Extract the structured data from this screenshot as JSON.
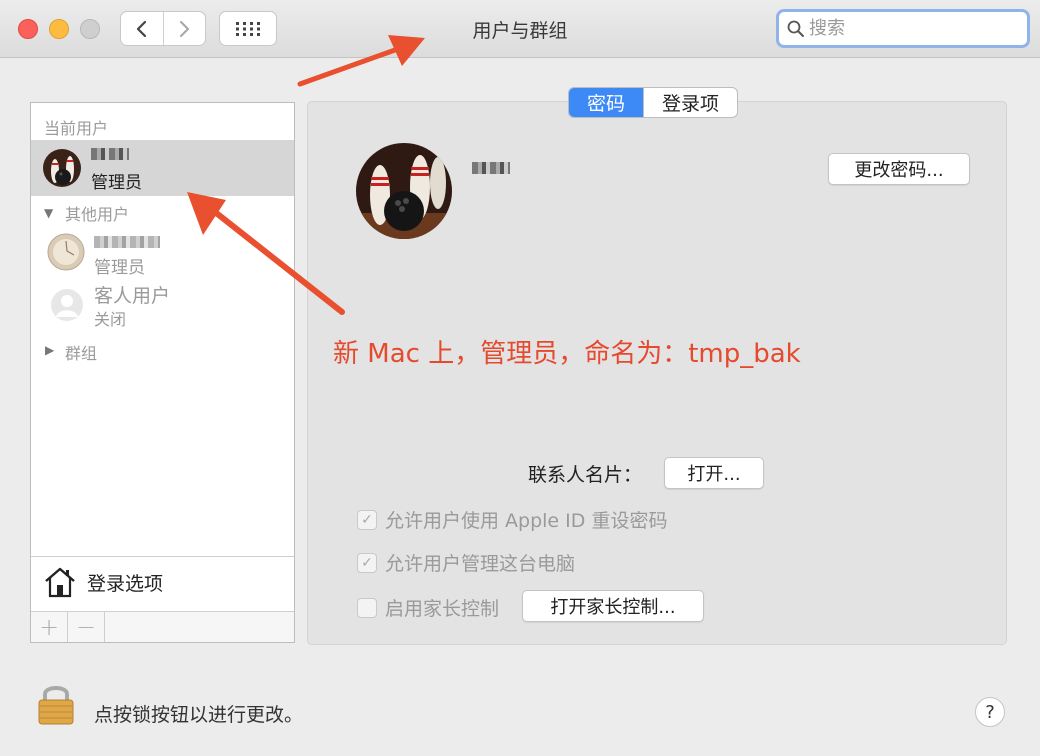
{
  "window": {
    "title": "用户与群组"
  },
  "search": {
    "placeholder": "搜索"
  },
  "tabs": [
    {
      "label": "密码",
      "active": true
    },
    {
      "label": "登录项",
      "active": false
    }
  ],
  "sidebar": {
    "current_users_header": "当前用户",
    "current_user": {
      "role": "管理员"
    },
    "other_users_header": "其他用户",
    "other_users": [
      {
        "role": "管理员"
      },
      {
        "name": "客人用户",
        "role": "关闭"
      }
    ],
    "groups_header": "群组",
    "login_options_label": "登录选项"
  },
  "main": {
    "change_password_label": "更改密码...",
    "contact_card_label": "联系人名片：",
    "open_label": "打开...",
    "checkboxes": [
      {
        "label": "允许用户使用 Apple ID 重设密码",
        "checked": true
      },
      {
        "label": "允许用户管理这台电脑",
        "checked": true
      },
      {
        "label": "启用家长控制",
        "checked": false
      }
    ],
    "parental_controls_button": "打开家长控制..."
  },
  "annotation": "新 Mac 上，管理员，命名为：tmp_bak",
  "footer": {
    "lock_text": "点按锁按钮以进行更改。",
    "help_label": "?"
  },
  "colors": {
    "accent": "#3d8af7",
    "annotation": "#e64a2e"
  }
}
